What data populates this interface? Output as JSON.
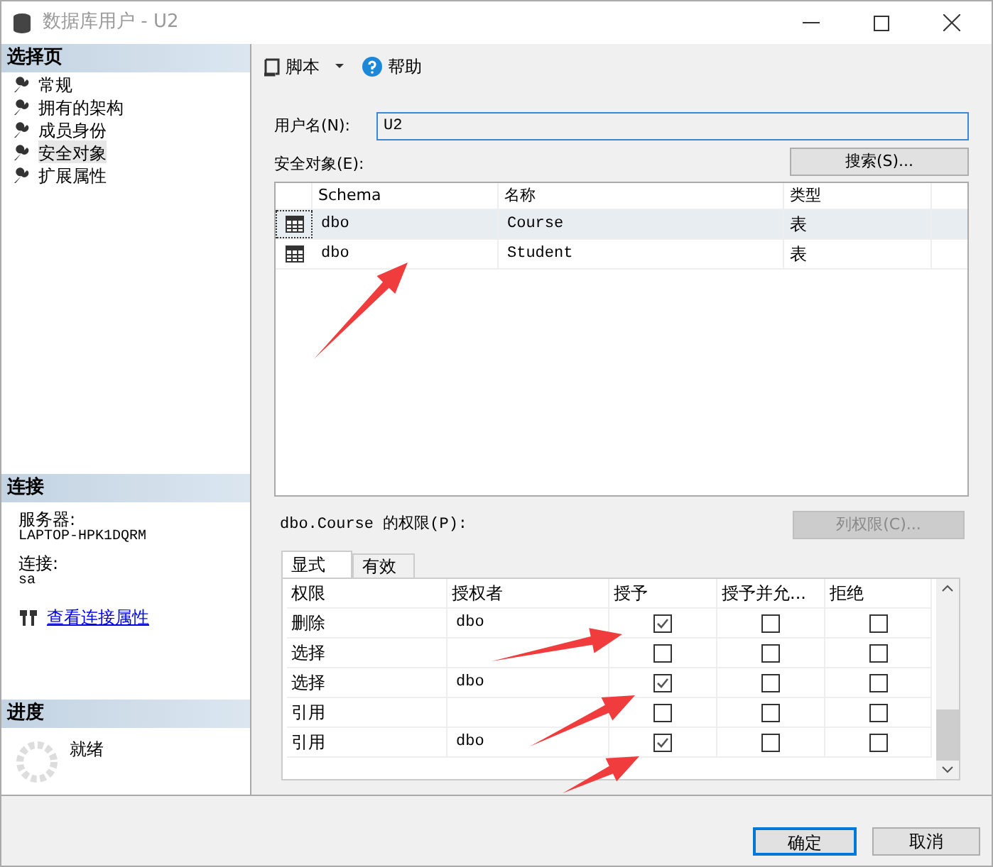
{
  "window": {
    "title": "数据库用户 - U2"
  },
  "sidebar": {
    "header": "选择页",
    "items": [
      {
        "label": "常规",
        "selected": false
      },
      {
        "label": "拥有的架构",
        "selected": false
      },
      {
        "label": "成员身份",
        "selected": false
      },
      {
        "label": "安全对象",
        "selected": true
      },
      {
        "label": "扩展属性",
        "selected": false
      }
    ]
  },
  "connection": {
    "header": "连接",
    "server_label": "服务器:",
    "server": "LAPTOP-HPK1DQRM",
    "connection_label": "连接:",
    "connection": "sa",
    "link": "查看连接属性"
  },
  "progress": {
    "header": "进度",
    "status": "就绪"
  },
  "toolbar": {
    "script": "脚本",
    "help": "帮助"
  },
  "username": {
    "label": "用户名(N):",
    "value": "U2"
  },
  "securables": {
    "label": "安全对象(E):",
    "search_button": "搜索(S)...",
    "columns": [
      "Schema",
      "名称",
      "类型"
    ],
    "rows": [
      {
        "schema": "dbo",
        "name": "Course",
        "type": "表",
        "selected": true
      },
      {
        "schema": "dbo",
        "name": "Student",
        "type": "表",
        "selected": false
      }
    ]
  },
  "permissions": {
    "label": "dbo.Course 的权限(P):",
    "column_button": "列权限(C)...",
    "column_button_disabled": true,
    "tabs": [
      {
        "label": "显式",
        "selected": true
      },
      {
        "label": "有效",
        "selected": false
      }
    ],
    "columns": [
      "权限",
      "授权者",
      "授予",
      "授予并允...",
      "拒绝"
    ],
    "rows": [
      {
        "permission": "删除",
        "grantor": "dbo",
        "grant": true,
        "with_grant": false,
        "deny": false
      },
      {
        "permission": "选择",
        "grantor": "",
        "grant": false,
        "with_grant": false,
        "deny": false
      },
      {
        "permission": "选择",
        "grantor": "dbo",
        "grant": true,
        "with_grant": false,
        "deny": false
      },
      {
        "permission": "引用",
        "grantor": "",
        "grant": false,
        "with_grant": false,
        "deny": false
      },
      {
        "permission": "引用",
        "grantor": "dbo",
        "grant": true,
        "with_grant": false,
        "deny": false
      }
    ]
  },
  "buttons": [
    "确定",
    "取消"
  ]
}
